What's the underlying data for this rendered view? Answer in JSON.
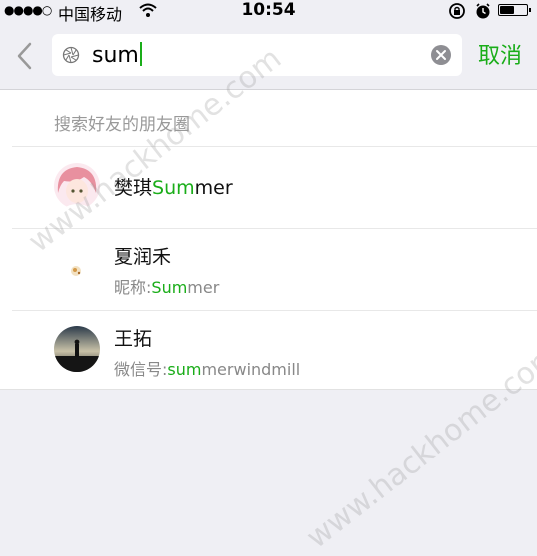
{
  "status_bar": {
    "signal": "●●●●○",
    "carrier": "中国移动",
    "time": "10:54"
  },
  "search": {
    "query": "sum",
    "cancel_label": "取消"
  },
  "section_title": "搜索好友的朋友圈",
  "results": [
    {
      "name_prefix": "樊琪",
      "name_match": "Sum",
      "name_suffix": "mer",
      "sub_prefix": "",
      "sub_match": "",
      "sub_suffix": ""
    },
    {
      "name_prefix": "夏润禾",
      "name_match": "",
      "name_suffix": "",
      "sub_prefix": "昵称:",
      "sub_match": "Sum",
      "sub_suffix": "mer"
    },
    {
      "name_prefix": "王拓",
      "name_match": "",
      "name_suffix": "",
      "sub_prefix": "微信号:",
      "sub_match": "sum",
      "sub_suffix": "merwindmill"
    }
  ],
  "watermark": "www.hackhome.com",
  "colors": {
    "accent": "#1aad19",
    "background": "#efeff4"
  }
}
